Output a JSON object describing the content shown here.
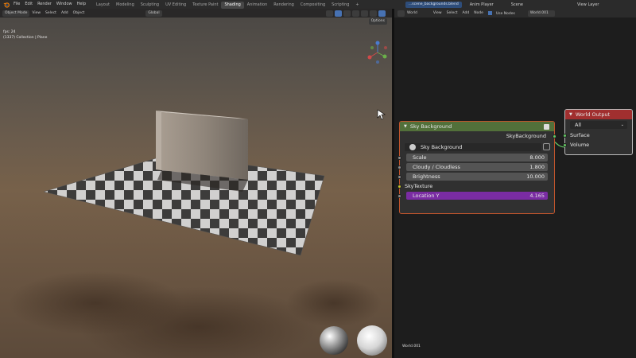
{
  "topbar": {
    "menu": [
      "File",
      "Edit",
      "Render",
      "Window",
      "Help"
    ],
    "workspaces": [
      "Layout",
      "Modeling",
      "Sculpting",
      "UV Editing",
      "Texture Paint",
      "Shading",
      "Animation",
      "Rendering",
      "Compositing",
      "Scripting"
    ],
    "active_workspace": "Shading",
    "file_name": "...scene_backgrounds.blend",
    "anim_label": "Anim Player",
    "scene_label": "Scene",
    "view_layer_label": "View Layer"
  },
  "viewport": {
    "mode": "Object Mode",
    "menu": [
      "View",
      "Select",
      "Add",
      "Object"
    ],
    "transform": "Global",
    "options": "Options",
    "fps": "fps: 24",
    "collection": "(1337) Collection | Plane"
  },
  "node_editor": {
    "type": "World",
    "menu": [
      "View",
      "Select",
      "Add",
      "Node"
    ],
    "use_nodes": "Use Nodes",
    "world_name": "World.001",
    "footer": "World.001"
  },
  "sky_node": {
    "title": "Sky Background",
    "output": "SkyBackground",
    "texture_name": "Sky Background",
    "inputs": [
      {
        "label": "Scale",
        "value": "8.000"
      },
      {
        "label": "Cloudy / Cloudless",
        "value": "1.800"
      },
      {
        "label": "Brightness",
        "value": "10.000"
      }
    ],
    "sky_texture_label": "SkyTexture",
    "location": {
      "label": "Location Y",
      "value": "4.165"
    }
  },
  "world_output_node": {
    "title": "World Output",
    "target": "All",
    "inputs": [
      "Surface",
      "Volume"
    ]
  },
  "colors": {
    "sky_header": "#52703a",
    "output_header": "#a12f2f",
    "accent": "#4772b3",
    "location_field": "#7a2ca3"
  }
}
